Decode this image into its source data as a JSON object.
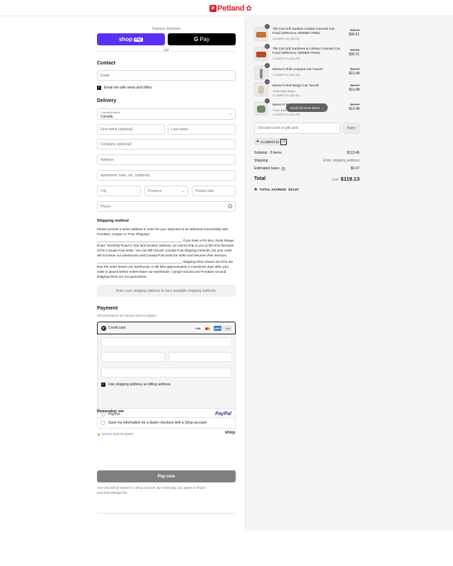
{
  "header": {
    "brand_text": "Petland",
    "brand_mark": "P"
  },
  "express": {
    "label": "Express checkout",
    "shop_pay": "shop",
    "shop_pay_tag": "Pay",
    "gpay": "Pay",
    "gpay_g": "G",
    "or": "OR"
  },
  "contact": {
    "title": "Contact",
    "email_placeholder": "Email",
    "news_label": "Email me with news and offers"
  },
  "delivery": {
    "title": "Delivery",
    "country_label": "Country/Region",
    "country_value": "Canada",
    "first_name": "First name (optional)",
    "last_name": "Last name",
    "company": "Company (optional)",
    "address": "Address",
    "apartment": "Apartment, suite, etc. (optional)",
    "city": "City",
    "province": "Province",
    "postal": "Postal code",
    "phone": "Phone"
  },
  "shipping": {
    "title": "Shipping method",
    "para1": "Please provide a street address in order for your shipment to be delivered successfully with Purolator, Canpar or \"Free Shipping\".",
    "para2_line": "_______________________________________________",
    "para2": "If you have a PO Box, Rural Range Road, Township Road or Site land location address, we cannot ship to you at this time because of the Canada Post strike. You can still choose Canada Post shipping methods, but your order will not leave our warehouse until Canada Post ends the strike and resumes their services.",
    "para3_line": "_______________________________________________",
    "para3": "Shipping times shown are from the time the order leaves our warehouse. It will take approximately 2-4 business days after your order is placed before orders leave our warehouse. Canpar Ground and Purolator Ground shipping times are not guaranteed.",
    "box": "Enter your shipping address to view available shipping methods."
  },
  "payment": {
    "title": "Payment",
    "subtitle": "All transactions are secure and encrypted.",
    "card_label": "Credit card",
    "cards": [
      "VISA",
      "MC",
      "AMEX",
      "JCB"
    ],
    "billing_label": "Use shipping address as billing address",
    "paypal_label": "PayPal",
    "paypal_logo": "PayPal"
  },
  "remember": {
    "title": "Remember me",
    "save_label": "Save my information for a faster checkout with a Shop account",
    "secure": "Secure and encrypted",
    "shop_logo": "shop"
  },
  "pay_now": "Pay now",
  "footer_text": "Your info will be saved to a Shop account. By continuing, you agree to Shop's",
  "footer_text2": "and acknowledge the",
  "items": [
    {
      "qty": "1",
      "name": "Tiki Cat Grill Sardine Cutlets Canned Cat Food (SPECIAL ORDER ITEM)",
      "variant": "",
      "code": "CLUBPET10 (-$4.05)",
      "old": "$40.56",
      "new": "$36.51",
      "thumb_color": "#c9703b"
    },
    {
      "qty": "1",
      "name": "Tiki Cat Grill Sardines & Lobster Canned Cat Food (SPECIAL ORDER ITEM)",
      "variant": "",
      "code": "CLUBPET10 (-$4.05)",
      "old": "$40.56",
      "new": "$36.51",
      "thumb_color": "#b8452e"
    },
    {
      "qty": "1",
      "name": "Meow N Roll Leopard Cat Tunnel",
      "variant": "",
      "code": "CLUBPET10 (-$1.49)",
      "old": "$14.97",
      "new": "$13.48",
      "thumb_color": "#8c8c86"
    },
    {
      "qty": "1",
      "name": "Meow N Roll Beige Cat Tunnel",
      "variant": "Three-Way Shape",
      "code": "CLUBPET10 (-$1.49)",
      "old": "$14.97",
      "new": "$13.48",
      "thumb_color": "#d6c6a2"
    },
    {
      "qty": "1",
      "name": "Meow N R",
      "variant": "Three-Way",
      "code": "CLUBPET10 (-$1.49)",
      "old": "$14.97",
      "new": "$13.48",
      "thumb_color": "#6f8a5f"
    }
  ],
  "scroll_pill": "Scroll for more items",
  "discount": {
    "placeholder": "Discount code or gift card",
    "apply": "Apply",
    "tag": "CLUBPET10"
  },
  "summary": {
    "subtotal_label": "Subtotal · 5 items",
    "subtotal": "$113.46",
    "shipping_label": "Shipping",
    "shipping_value": "Enter shipping address",
    "taxes_label": "Estimated taxes",
    "taxes": "$5.67",
    "total_label": "Total",
    "currency": "CAD",
    "total": "$119.13",
    "savings_label": "TOTAL SAVINGS",
    "savings": "$12.57"
  }
}
